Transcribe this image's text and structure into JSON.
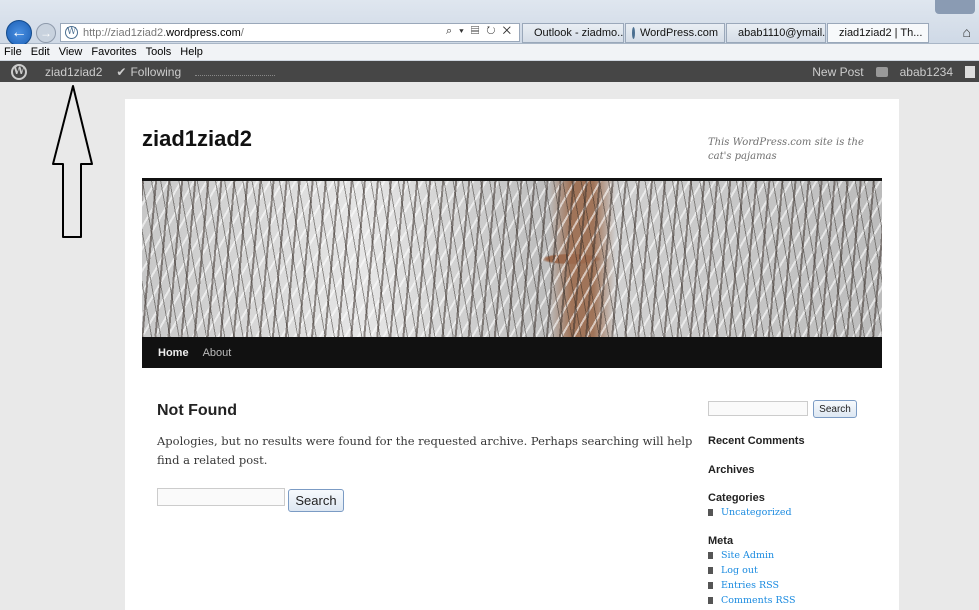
{
  "browser": {
    "address": {
      "prefix": "http://ziad1ziad2.",
      "host": "wordpress.com",
      "suffix": "/",
      "tools": "⌕ ▾ ▤ ↻ ✕"
    },
    "tabs": [
      {
        "label": "Outlook - ziadmo...",
        "icon_color": "#e8a21c",
        "active": false
      },
      {
        "label": "WordPress.com",
        "icon_color": "#4b6f90",
        "active": false
      },
      {
        "label": "abab1110@ymail....",
        "icon_color": "#7b3fa8",
        "active": false
      },
      {
        "label": "ziad1ziad2 | Th...",
        "icon_color": "#4b6f90",
        "active": true
      }
    ],
    "tab_close": "×",
    "home": "⌂",
    "menu": [
      "File",
      "Edit",
      "View",
      "Favorites",
      "Tools",
      "Help"
    ]
  },
  "adminbar": {
    "site": "ziad1ziad2",
    "following": "Following",
    "new_post": "New Post",
    "user": "abab1234"
  },
  "site": {
    "title": "ziad1ziad2",
    "tagline": "This WordPress.com site is the cat's pajamas"
  },
  "nav": {
    "home": "Home",
    "about": "About"
  },
  "content": {
    "title": "Not Found",
    "text": "Apologies, but no results were found for the requested archive. Perhaps searching will help find a related post.",
    "search_label": "Search"
  },
  "sidebar": {
    "search_label": "Search",
    "recent_comments": "Recent Comments",
    "archives": "Archives",
    "categories": {
      "title": "Categories",
      "items": [
        "Uncategorized"
      ]
    },
    "meta": {
      "title": "Meta",
      "items": [
        "Site Admin",
        "Log out",
        "Entries RSS",
        "Comments RSS"
      ]
    }
  }
}
